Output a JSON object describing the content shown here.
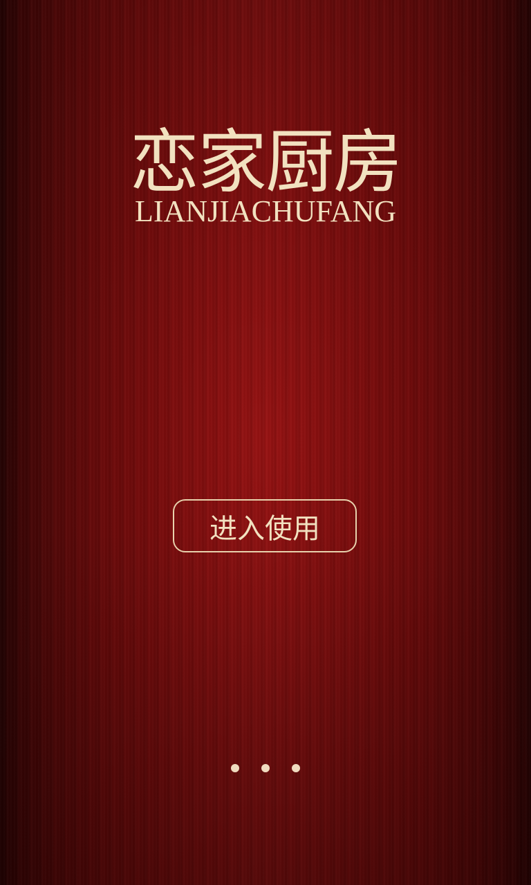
{
  "splash": {
    "title": "恋家厨房",
    "subtitle": "LIANJIACHUFANG",
    "enter_label": "进入使用"
  },
  "pager": {
    "total": 3,
    "active_index": null
  },
  "colors": {
    "background": "#8a0f0f",
    "text": "#f2e1c0",
    "button_border": "#e8d2ad"
  }
}
